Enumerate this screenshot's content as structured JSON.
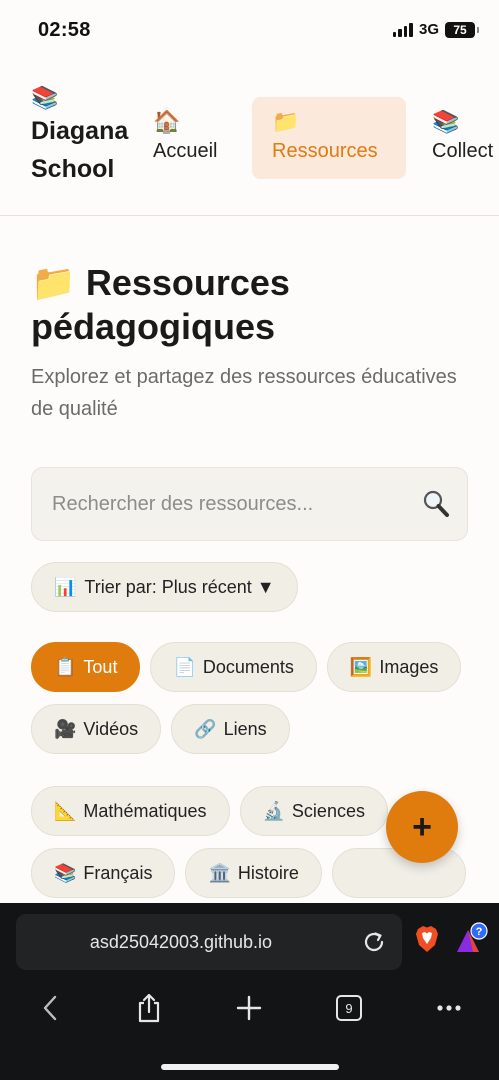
{
  "status": {
    "time": "02:58",
    "network": "3G",
    "battery": "75"
  },
  "nav": {
    "brand_icon": "📚",
    "brand_name": "Diagana School",
    "items": [
      {
        "icon": "🏠",
        "label": "Accueil"
      },
      {
        "icon": "📁",
        "label": "Ressources"
      },
      {
        "icon": "📚",
        "label": "Collect"
      }
    ]
  },
  "page": {
    "title": "📁 Ressources pédagogiques",
    "subtitle": "Explorez et partagez des ressources éducatives de qualité"
  },
  "search": {
    "placeholder": "Rechercher des ressources...",
    "icon": "search-icon"
  },
  "sort": {
    "icon": "📊",
    "label": "Trier par: Plus récent ▼"
  },
  "type_filters": [
    {
      "icon": "📋",
      "label": "Tout"
    },
    {
      "icon": "📄",
      "label": "Documents"
    },
    {
      "icon": "🖼️",
      "label": "Images"
    },
    {
      "icon": "🎥",
      "label": "Vidéos"
    },
    {
      "icon": "🔗",
      "label": "Liens"
    }
  ],
  "subject_filters": [
    {
      "icon": "📐",
      "label": "Mathématiques"
    },
    {
      "icon": "🔬",
      "label": "Sciences"
    },
    {
      "icon": "📚",
      "label": "Français"
    },
    {
      "icon": "🏛️",
      "label": "Histoire"
    }
  ],
  "fab": {
    "label": "+"
  },
  "browser": {
    "url": "asd25042003.github.io",
    "tab_count": "9"
  },
  "colors": {
    "accent": "#e07b0e",
    "accent_light": "#fbeadb",
    "chip_bg": "#f1eee6",
    "browser_bg": "#131415"
  }
}
